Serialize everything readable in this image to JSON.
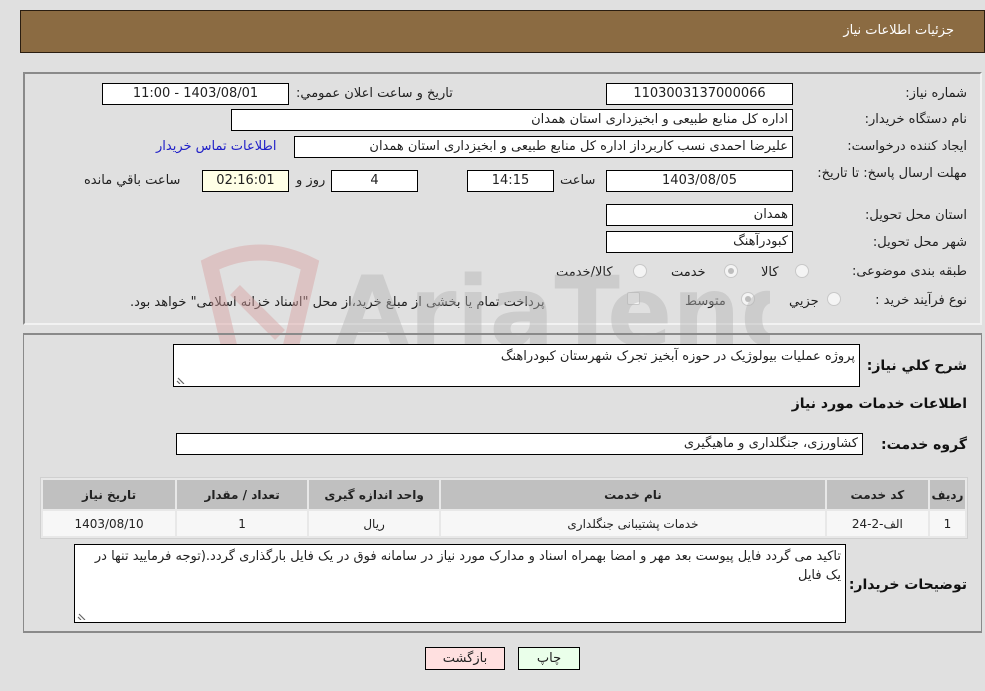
{
  "header": {
    "title": "جزئیات اطلاعات نیاز"
  },
  "form": {
    "need_number": {
      "label": "شماره نیاز:",
      "value": "1103003137000066"
    },
    "announce_datetime": {
      "label": "تاریخ و ساعت اعلان عمومي:",
      "value": "1403/08/01 - 11:00"
    },
    "buyer_org": {
      "label": "نام دستگاه خریدار:",
      "value": "اداره کل منابع طبیعی و ابخیزداری استان همدان"
    },
    "requester": {
      "label": "ایجاد کننده درخواست:",
      "value": "علیرضا احمدی نسب کاربرداز اداره کل منابع طبیعی و ابخیزداری استان همدان"
    },
    "buyer_contact_link": "اطلاعات تماس خریدار",
    "deadline": {
      "label": "مهلت ارسال پاسخ: تا تاریخ:",
      "date": "1403/08/05",
      "time_label": "ساعت",
      "time": "14:15",
      "days": "4",
      "days_label": "روز و",
      "remaining": "02:16:01",
      "remaining_label": "ساعت باقي مانده"
    },
    "delivery_province": {
      "label": "استان محل تحویل:",
      "value": "همدان"
    },
    "delivery_city": {
      "label": "شهر محل تحویل:",
      "value": "کبودرآهنگ"
    },
    "category": {
      "label": "طبقه بندی موضوعی:",
      "options": [
        {
          "label": "کالا",
          "checked": false
        },
        {
          "label": "خدمت",
          "checked": true
        },
        {
          "label": "کالا/خدمت",
          "checked": false
        }
      ]
    },
    "purchase_process": {
      "label": "نوع فرآیند خرید :",
      "options": [
        {
          "label": "جزيي",
          "checked": false
        },
        {
          "label": "متوسط",
          "checked": true
        }
      ],
      "treasury_checkbox_label": "پرداخت تمام یا بخشی از مبلغ خرید،از محل \"اسناد خزانه اسلامی\" خواهد بود.",
      "treasury_checked": false
    }
  },
  "description": {
    "label": "شرح کلي نیاز:",
    "value": "پروژه عملیات بیولوژیک در حوزه آبخیز تجرک شهرستان کبودراهنگ"
  },
  "services_section": {
    "title": "اطلاعات خدمات مورد نیاز"
  },
  "service_group": {
    "label": "گروه خدمت:",
    "value": "کشاورزی، جنگلداری و ماهیگیری"
  },
  "services_table": {
    "columns": [
      "ردیف",
      "کد خدمت",
      "نام خدمت",
      "واحد اندازه گیری",
      "تعداد / مقدار",
      "تاریخ نیاز"
    ],
    "rows": [
      [
        "1",
        "الف-2-24",
        "خدمات پشتیبانی جنگلداری",
        "ریال",
        "1",
        "1403/08/10"
      ]
    ]
  },
  "buyer_notes": {
    "label": "توضیحات خریدار:",
    "value": "تاکید می گردد فایل پیوست بعد مهر و امضا بهمراه اسناد و مدارک مورد نیاز در سامانه فوق در یک فایل بارگذاری گردد.(توجه فرمایید تنها در یک فایل"
  },
  "buttons": {
    "print": "چاپ",
    "back": "بازگشت"
  },
  "watermark": {
    "text": "AriaTender.neT"
  },
  "colors": {
    "header_bg": "#8b6b42",
    "page_bg": "#e0e0e0",
    "link": "#2020c8",
    "back_btn": "#ffe0e0",
    "print_btn": "#eaffea"
  }
}
